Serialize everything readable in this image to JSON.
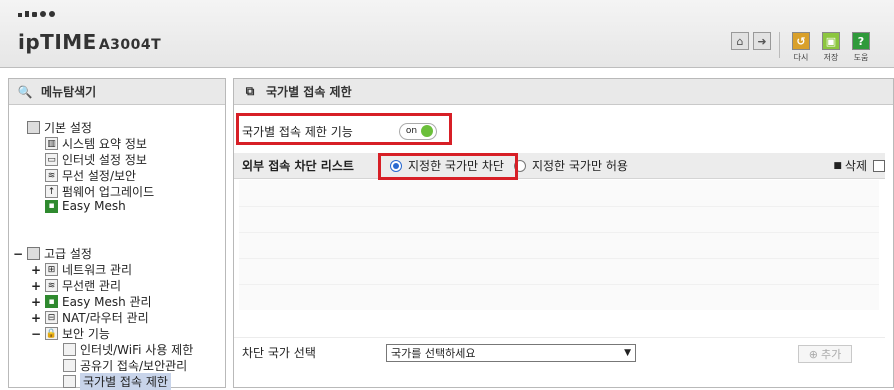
{
  "header": {
    "brand": "ipTIME",
    "model": "A3004T",
    "icons": [
      "home-icon",
      "logout-icon"
    ],
    "tools": [
      {
        "name": "reset",
        "label": "다시",
        "color": "#d9a02a"
      },
      {
        "name": "save",
        "label": "저장",
        "color": "#8cc63f"
      },
      {
        "name": "help",
        "label": "도움",
        "color": "#2f9a3a"
      }
    ]
  },
  "sidebar": {
    "title": "메뉴탐색기",
    "basic_group": "기본 설정",
    "basic_items": [
      "시스템 요약 정보",
      "인터넷 설정 정보",
      "무선 설정/보안",
      "펌웨어 업그레이드",
      "Easy Mesh"
    ],
    "advanced_group": "고급 설정",
    "advanced_items": [
      "네트워크 관리",
      "무선랜 관리",
      "Easy Mesh 관리",
      "NAT/라우터 관리"
    ],
    "security_group": "보안 기능",
    "security_items": [
      "인터넷/WiFi 사용 제한",
      "공유기 접속/보안관리",
      "국가별 접속 제한"
    ]
  },
  "main": {
    "title": "국가별 접속 제한",
    "feature_label": "국가별 접속 제한 기능",
    "toggle_text": "on",
    "toggle_color": "#6bbf3a",
    "list_label": "외부 접속 차단 리스트",
    "radio_block": "지정한 국가만 차단",
    "radio_allow": "지정한 국가만 허용",
    "delete_label": "삭제",
    "select_label": "차단 국가 선택",
    "select_value": "국가를 선택하세요",
    "add_button": "추가",
    "highlight_color": "#d71f26"
  }
}
